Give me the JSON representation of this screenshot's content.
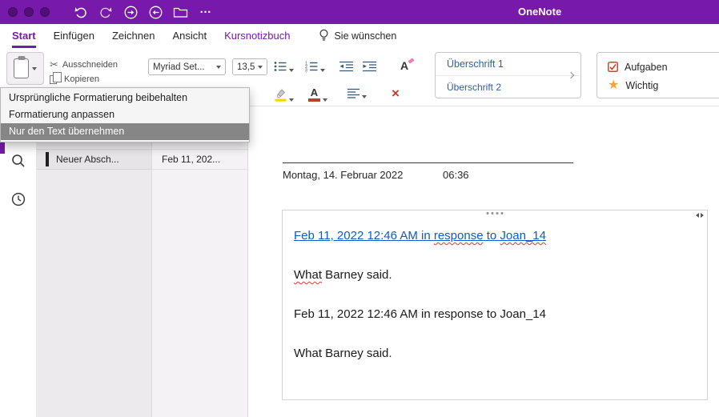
{
  "colors": {
    "titlebar_purple": "#7719aa",
    "accent_purple": "#7719aa",
    "link_blue": "#0b5bcb",
    "spellcheck_red": "#e03b2f",
    "tag_checkbox_red": "#d6402f",
    "tag_star_orange": "#f2a33c",
    "highlighter_yellow": "#ffd400",
    "menu_selection_gray": "#868686"
  },
  "titlebar": {
    "app_title": "OneNote"
  },
  "tabs": [
    {
      "label": "Start"
    },
    {
      "label": "Einfügen"
    },
    {
      "label": "Zeichnen"
    },
    {
      "label": "Ansicht"
    },
    {
      "label": "Kursnotizbuch"
    }
  ],
  "tellme": {
    "label": "Sie wünschen"
  },
  "ribbon": {
    "cut_label": "Ausschneiden",
    "copy_label": "Kopieren",
    "font_name": "Myriad Set...",
    "font_size": "13,5",
    "styles": [
      {
        "label": "Überschrift 1"
      },
      {
        "label": "Überschrift 2"
      }
    ],
    "tags": [
      {
        "label": "Aufgaben"
      },
      {
        "label": "Wichtig"
      }
    ]
  },
  "paste_menu": {
    "items": [
      {
        "label": "Ursprüngliche Formatierung beibehalten",
        "selected": false
      },
      {
        "label": "Formatierung anpassen",
        "selected": false
      },
      {
        "label": "Nur den Text übernehmen",
        "selected": true
      }
    ]
  },
  "navigation": {
    "section_label": "Neuer Absch...",
    "page_label": "Feb 11, 202..."
  },
  "page": {
    "date": "Montag, 14. Februar 2022",
    "time": "06:36",
    "note": {
      "link_parts": [
        {
          "text": "Feb 11, 2022 12:46 AM in "
        },
        {
          "text": "response"
        },
        {
          "text": " to "
        },
        {
          "text": "Joan_14"
        }
      ],
      "para2_parts": [
        {
          "text": "What"
        },
        {
          "text": " Barney said."
        }
      ],
      "para3": "Feb 11, 2022 12:46 AM in response to Joan_14",
      "para4": "What Barney said."
    }
  }
}
